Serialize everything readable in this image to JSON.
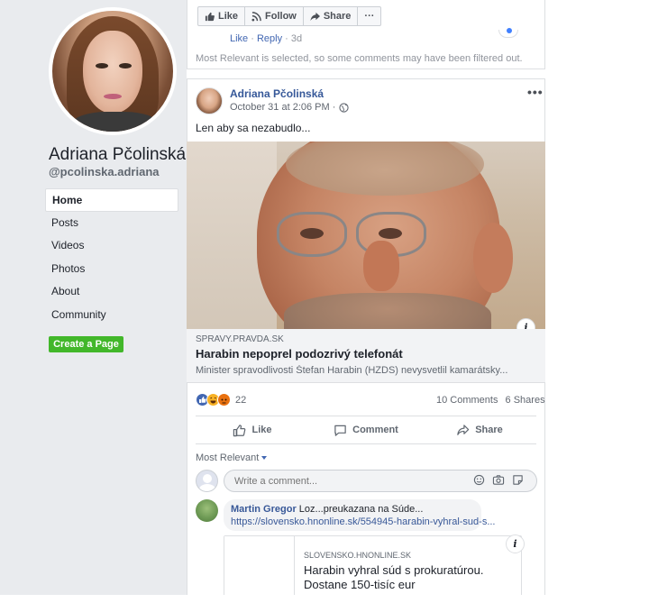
{
  "sidebar": {
    "page_name": "Adriana Pčolinská",
    "page_handle": "@pcolinska.adriana",
    "nav": [
      {
        "label": "Home",
        "active": true
      },
      {
        "label": "Posts",
        "active": false
      },
      {
        "label": "Videos",
        "active": false
      },
      {
        "label": "Photos",
        "active": false
      },
      {
        "label": "About",
        "active": false
      },
      {
        "label": "Community",
        "active": false
      }
    ],
    "create_page_label": "Create a Page"
  },
  "previous_post": {
    "actions": {
      "like": "Like",
      "follow": "Follow",
      "share": "Share",
      "more": "···"
    },
    "comment_meta": {
      "like": "Like",
      "sep": "·",
      "reply": "Reply",
      "time": "3d"
    },
    "filtered_note": "Most Relevant is selected, so some comments may have been filtered out."
  },
  "post": {
    "author": "Adriana Pčolinská",
    "time": "October 31 at 2:06 PM ·",
    "more": "•••",
    "text": "Len aby sa nezabudlo...",
    "link": {
      "domain": "SPRAVY.PRAVDA.SK",
      "title": "Harabin nepoprel podozrivý telefonát",
      "description": "Minister spravodlivosti Štefan Harabin (HZDS) nevysvetlil kamarátsky..."
    },
    "info_badge": "i",
    "reaction_count": "22",
    "comments_count": "10 Comments",
    "shares_count": "6 Shares",
    "actions": {
      "like": "Like",
      "comment": "Comment",
      "share": "Share"
    },
    "relevance_label": "Most Relevant",
    "comment_placeholder": "Write a comment...",
    "comment": {
      "author": "Martin Gregor",
      "text": "Loz...preukazana na Súde...",
      "link": "https://slovensko.hnonline.sk/554945-harabin-vyhral-sud-s...",
      "preview": {
        "domain": "SLOVENSKO.HNONLINE.SK",
        "title": "Harabin vyhral súd s prokuratúrou. Dostane 150-tisíc eur"
      }
    }
  },
  "colors": {
    "sidebar_bg": "#e9ebee",
    "link_blue": "#365899",
    "create_green": "#42b72a"
  }
}
